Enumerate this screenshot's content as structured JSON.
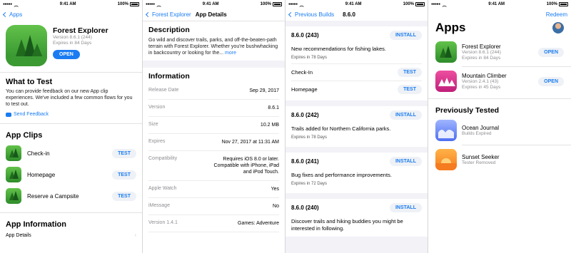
{
  "status": {
    "time": "9:41 AM",
    "battery": "100%"
  },
  "screen1": {
    "back_label": "Apps",
    "app_name": "Forest Explorer",
    "version": "Version 8.6.1 (244)",
    "expires": "Expires in 84 Days",
    "open_label": "OPEN",
    "what_to_test_title": "What to Test",
    "what_to_test_body": "You can provide feedback on our new App clip experiences. We've included a few common flows for you to test out.",
    "feedback_label": "Send Feedback",
    "app_clips_title": "App Clips",
    "clips": [
      {
        "label": "Check-in",
        "button": "TEST"
      },
      {
        "label": "Homepage",
        "button": "TEST"
      },
      {
        "label": "Reserve a Campsite",
        "button": "TEST"
      }
    ],
    "app_info_title": "App Information",
    "app_details_label": "App Details"
  },
  "screen2": {
    "back_label": "Forest Explorer",
    "title": "App Details",
    "description_title": "Description",
    "description_text": "Go wild and discover trails, parks, and off-the-beaten-path terrain with Forest Explorer. Whether you're bushwhacking in backcountry or looking for the...",
    "more_label": "more",
    "info_title": "Information",
    "info_rows": [
      {
        "key": "Release Date",
        "value": "Sep 29, 2017"
      },
      {
        "key": "Version",
        "value": "8.6.1"
      },
      {
        "key": "Size",
        "value": "10.2 MB"
      },
      {
        "key": "Expires",
        "value": "Nov 27, 2017 at 11:31 AM"
      },
      {
        "key": "Compatibility",
        "value": "Requires iOS 8.0 or later. Compatible with iPhone, iPad and iPod Touch."
      },
      {
        "key": "Apple Watch",
        "value": "Yes"
      },
      {
        "key": "iMessage",
        "value": "No"
      },
      {
        "key": "Version 1.4.1",
        "value": "Games: Adventure"
      }
    ]
  },
  "screen3": {
    "back_label": "Previous Builds",
    "title": "8.6.0",
    "builds": [
      {
        "version": "8.6.0 (243)",
        "button": "INSTALL",
        "note": "New recommendations for fishing lakes.",
        "expires": "Expires in 78 Days",
        "clips": [
          {
            "label": "Check-In",
            "button": "TEST"
          },
          {
            "label": "Homepage",
            "button": "TEST"
          }
        ]
      },
      {
        "version": "8.6.0 (242)",
        "button": "INSTALL",
        "note": "Trails added for Northern California parks.",
        "expires": "Expires in 78 Days",
        "clips": []
      },
      {
        "version": "8.6.0 (241)",
        "button": "INSTALL",
        "note": "Bug fixes and performance improvements.",
        "expires": "Expires in 72 Days",
        "clips": []
      },
      {
        "version": "8.6.0 (240)",
        "button": "INSTALL",
        "note": "Discover trails and hiking buddies you might be interested in following.",
        "expires": "",
        "clips": []
      }
    ]
  },
  "screen4": {
    "right_label": "Redeem",
    "title": "Apps",
    "apps": [
      {
        "name": "Forest Explorer",
        "version": "Version 8.6.1 (244)",
        "expires": "Expires in 84 Days",
        "button": "OPEN",
        "color_top": "#62c24a",
        "color_bottom": "#2e8c2a"
      },
      {
        "name": "Mountain Climber",
        "version": "Version 2.4.1 (43)",
        "expires": "Expires in 45 Days",
        "button": "OPEN",
        "color_top": "#ee4fa0",
        "color_bottom": "#c01f7a"
      }
    ],
    "previous_title": "Previously Tested",
    "previous": [
      {
        "name": "Ocean Journal",
        "status": "Builds Expired",
        "color_top": "#9fb5ff",
        "color_bottom": "#4f6ff0"
      },
      {
        "name": "Sunset Seeker",
        "status": "Tester Removed",
        "color_top": "#ffb347",
        "color_bottom": "#f57c1f"
      }
    ]
  },
  "colors": {
    "accent": "#1a7cf2",
    "pill_bg": "#eef1f6",
    "secondary_text": "#8e8e93"
  }
}
